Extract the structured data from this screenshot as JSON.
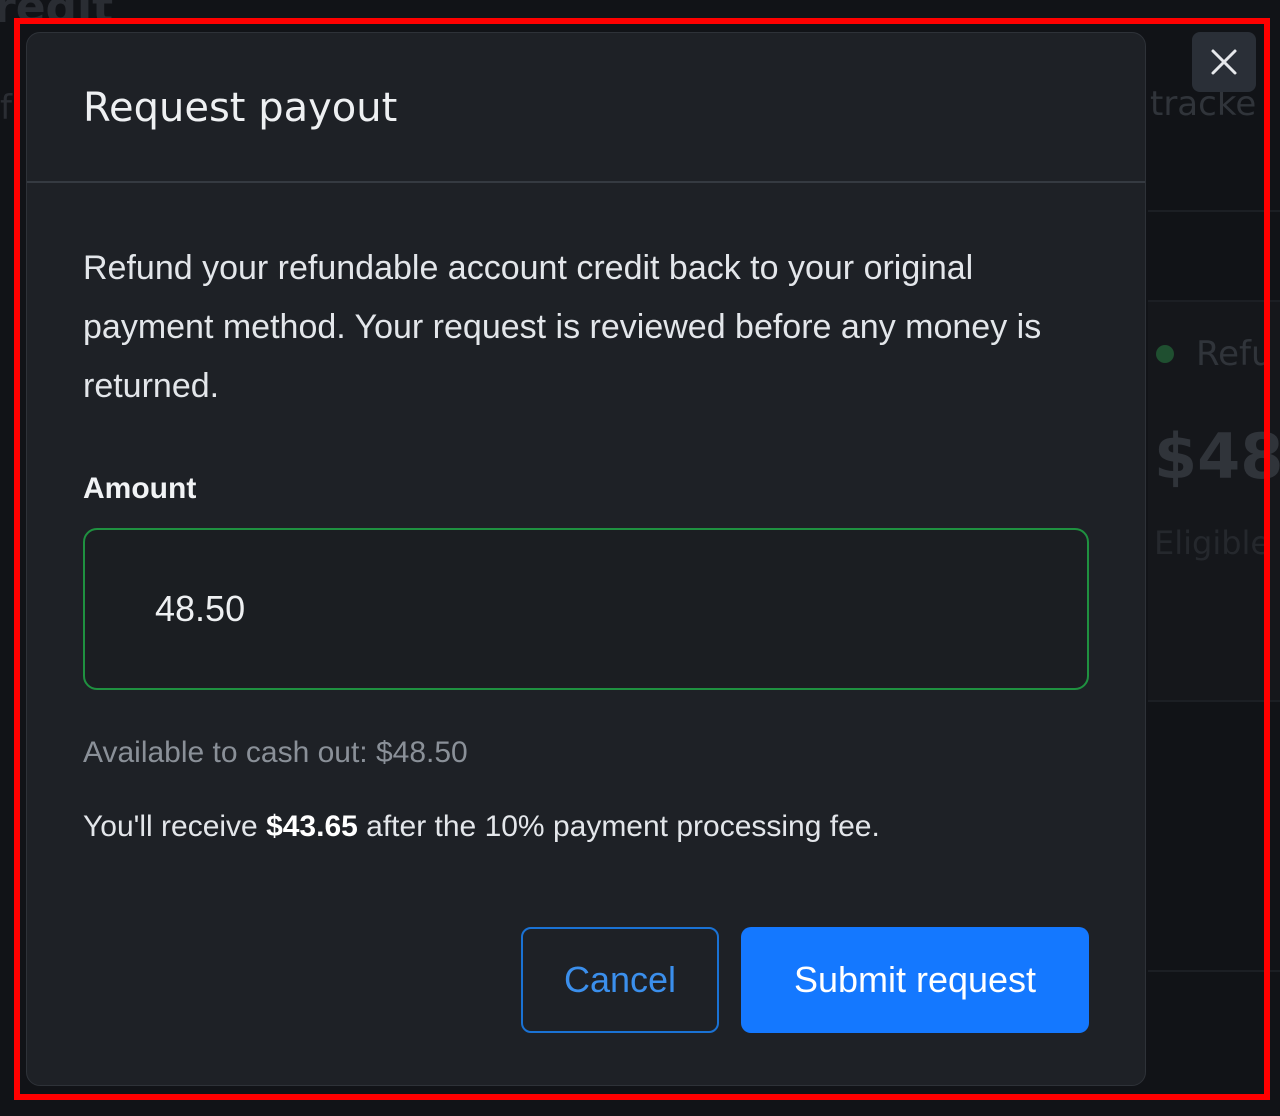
{
  "background": {
    "page_title": "redit",
    "left_fragment": "f",
    "right_fragment": "tracke",
    "refund_label": "Refu",
    "amount": "$48.",
    "eligible": "Eligible"
  },
  "modal": {
    "title": "Request payout",
    "description": "Refund your refundable account credit back to your original payment method. Your request is reviewed before any money is returned.",
    "amount_label": "Amount",
    "amount_value": "48.50",
    "available": "Available to cash out: $48.50",
    "receive_prefix": "You'll receive ",
    "receive_amount": "$43.65",
    "receive_suffix": " after the 10% payment processing fee.",
    "cancel_label": "Cancel",
    "submit_label": "Submit request"
  },
  "icons": {
    "close": "close-icon"
  },
  "colors": {
    "accent": "#1478ff",
    "input_border": "#1f9140",
    "highlight": "#ff0000"
  }
}
